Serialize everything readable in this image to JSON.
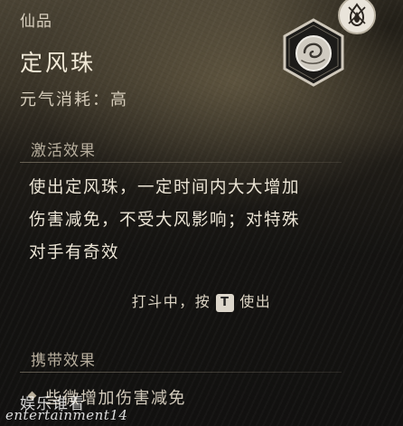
{
  "item": {
    "tier": "仙品",
    "name": "定风珠",
    "cost_label": "元气消耗：",
    "cost_value": "高"
  },
  "sections": {
    "activate_title": "激活效果",
    "activate_desc_line1": "使出定风珠，一定时间内大大增加",
    "activate_desc_line2": "伤害减免，不受大风影响；对特殊",
    "activate_desc_line3": "对手有奇效",
    "hint_prefix": "打斗中，按",
    "hint_key": "T",
    "hint_suffix": "使出",
    "carry_title": "携带效果",
    "carry_text": "些微增加伤害减免"
  },
  "watermark": {
    "cn": "娱乐谁看",
    "en": "entertainment14"
  },
  "icons": {
    "badge": "flame-emblem-icon",
    "item": "wind-pearl-icon"
  },
  "colors": {
    "name_text": "#f2ead8",
    "section_title": "#b7ae9d"
  }
}
